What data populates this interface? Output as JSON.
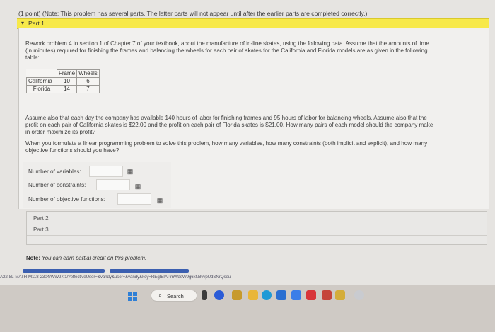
{
  "header": {
    "title": "(1 point) (Note: This problem has several parts. The latter parts will not appear until after the earlier parts are completed correctly.)",
    "part_label": "Part 1",
    "caret": "▾"
  },
  "problem": {
    "intro_lines": [
      "Rework problem 4 in section 1 of Chapter 7 of your textbook, about the manufacture of in-line skates, using the following data. Assume that the amounts of time",
      "(in minutes) required for finishing the frames and balancing the wheels for each pair of skates for the California and Florida models are as given in the following",
      "table:"
    ],
    "table": {
      "headers": [
        "",
        "Frame",
        "Wheels"
      ],
      "rows": [
        [
          "California",
          "10",
          "6"
        ],
        [
          "Florida",
          "14",
          "7"
        ]
      ]
    },
    "assume_lines": [
      "Assume also that each day the company has available 140 hours of labor for finishing frames and 95 hours of labor for balancing wheels. Assume also that the",
      "profit on each pair of California skates is $22.00 and the profit on each pair of Florida skates is $21.00. How many pairs of each model should the company make",
      "in order maximize its profit?"
    ],
    "question_lines": [
      "When you formulate a linear programming problem to solve this problem, how many variables, how many constraints (both implicit and explicit), and how many",
      "objective functions should you have?"
    ]
  },
  "fields": {
    "variables_label": "Number of variables:",
    "variables_value": "",
    "constraints_label": "Number of constraints:",
    "constraints_value": "",
    "objectives_label": "Number of objective functions:",
    "objectives_value": "",
    "keypad_glyph": "▦"
  },
  "parts": [
    "Part 2",
    "Part 3"
  ],
  "note": {
    "prefix": "Note:",
    "text": " You can earn partial credit on this problem."
  },
  "url": "A22-8L-MATH-M118-2304/WW27/1/?effectiveUser=&vandy&user=&vandy&key=REgIEIAPmWasW9g6xN8vvpUdSNrQseu",
  "taskbar": {
    "search_label": "Search",
    "search_glyph": "⌕"
  },
  "colors": {
    "part_bar": "#f7e94a",
    "windows_blue": "#2f7fd6"
  }
}
